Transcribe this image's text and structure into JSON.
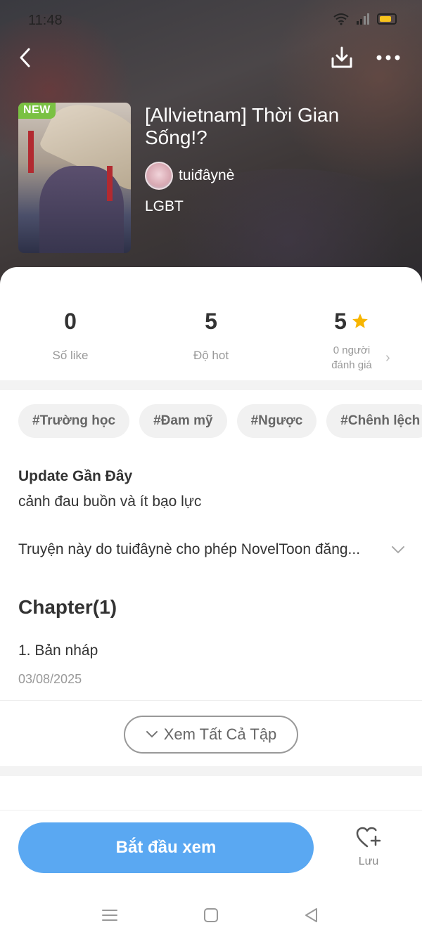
{
  "status_bar": {
    "time": "11:48"
  },
  "book": {
    "badge": "NEW",
    "title": "[Allvietnam] Thời Gian Sống!?",
    "author": "tuiđâynè",
    "genre": "LGBT"
  },
  "stats": {
    "likes": {
      "value": "0",
      "label": "Số like"
    },
    "hot": {
      "value": "5",
      "label": "Độ hot"
    },
    "rating": {
      "value": "5",
      "label_line1": "0 người",
      "label_line2": "đánh giá"
    }
  },
  "tags": [
    "#Trường học",
    "#Đam mỹ",
    "#Ngược",
    "#Chênh lệch"
  ],
  "update": {
    "title": "Update Gần Đây",
    "text": "cảnh đau buồn và ít bạo lực"
  },
  "description": "Truyện này do tuiđâynè cho phép NovelToon đăng...",
  "chapters": {
    "title": "Chapter(1)",
    "items": [
      {
        "name": "1. Bản nháp",
        "date": "03/08/2025"
      }
    ],
    "view_all": "Xem Tất Cả Tập"
  },
  "footer": {
    "start_label": "Bắt đầu xem",
    "save_label": "Lưu"
  },
  "colors": {
    "primary": "#5aa8f2",
    "new_badge": "#7ac143",
    "star": "#f7b500"
  }
}
